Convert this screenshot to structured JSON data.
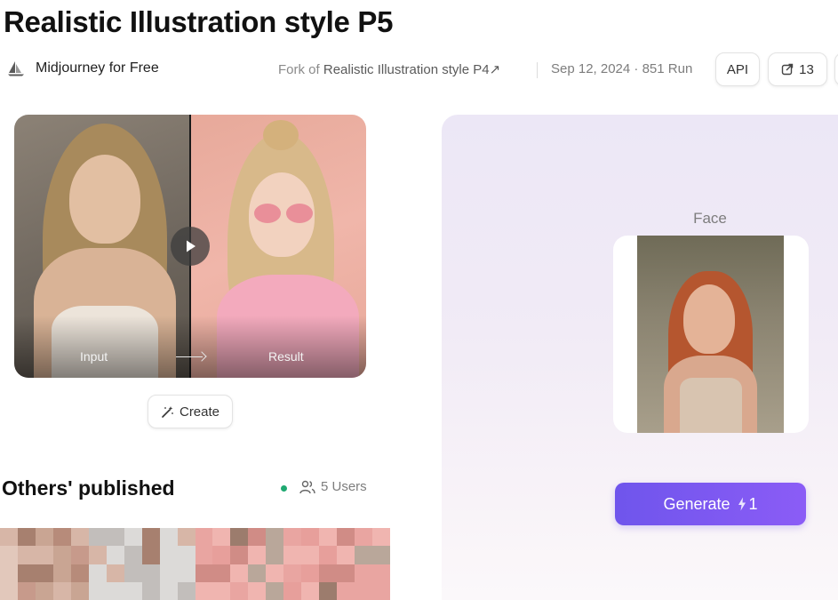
{
  "page": {
    "title": "Realistic Illustration style P5"
  },
  "meta": {
    "author": {
      "name": "Midjourney for Free",
      "icon": "sailboat-logo-icon"
    },
    "fork_prefix": "Fork of",
    "fork_name": "Realistic Illustration style P4",
    "fork_arrow": "↗",
    "date_runs": "Sep 12, 2024 · 851 Run",
    "api_label": "API",
    "share_count": "13"
  },
  "preview": {
    "input_label": "Input",
    "result_label": "Result"
  },
  "create_button": {
    "label": "Create",
    "icon": "magic-wand-icon"
  },
  "others": {
    "title": "Others' published",
    "users_label": "5 Users",
    "online_color": "#1fa971"
  },
  "panel": {
    "face_label": "Face",
    "generate_label": "Generate",
    "generate_cost": "1",
    "accent": "#7c5cf0"
  }
}
